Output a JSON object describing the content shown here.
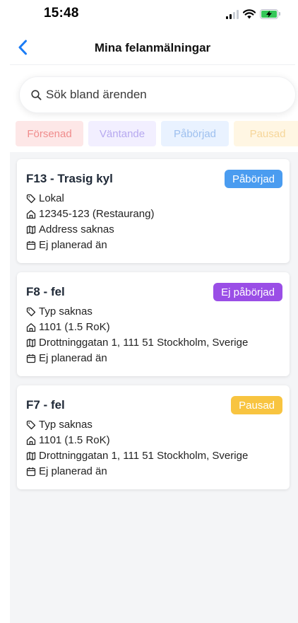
{
  "status": {
    "time": "15:48"
  },
  "nav": {
    "title": "Mina felanmälningar"
  },
  "search": {
    "placeholder": "Sök bland ärenden"
  },
  "filters": [
    {
      "label": "Försenad"
    },
    {
      "label": "Väntande"
    },
    {
      "label": "Påbörjad"
    },
    {
      "label": "Pausad"
    }
  ],
  "colors": {
    "accent": "#1a7cf5",
    "status_paborjad": "#4a9cf0",
    "status_ej_paborjad": "#9a4ee6",
    "status_pausad": "#f8c440"
  },
  "cards": [
    {
      "title": "F13 - Trasig kyl",
      "status": "Påbörjad",
      "type": "Lokal",
      "unit": "12345-123 (Restaurang)",
      "address": "Address saknas",
      "schedule": "Ej planerad än"
    },
    {
      "title": "F8 - fel",
      "status": "Ej påbörjad",
      "type": "Typ saknas",
      "unit": "1101 (1.5 RoK)",
      "address": "Drottninggatan 1, 111 51 Stockholm, Sverige",
      "schedule": "Ej planerad än"
    },
    {
      "title": "F7 - fel",
      "status": "Pausad",
      "type": "Typ saknas",
      "unit": "1101 (1.5 RoK)",
      "address": "Drottninggatan 1, 111 51 Stockholm, Sverige",
      "schedule": "Ej planerad än"
    }
  ]
}
